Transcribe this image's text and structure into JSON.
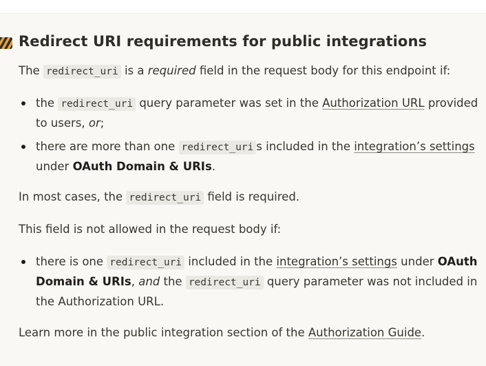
{
  "callout": {
    "icon": "warning-stripe-icon",
    "heading": "Redirect URI requirements for public integrations",
    "intro": {
      "t1": "The ",
      "code": "redirect_uri",
      "t2": " is a ",
      "em": "required",
      "t3": " field in the request body for this endpoint if:"
    },
    "list1": [
      {
        "t1": "the ",
        "code": "redirect_uri",
        "t2": " query parameter was set in the ",
        "link": "Authorization URL",
        "t3": " provided",
        "line2": "to users, ",
        "em": "or",
        "t4": ";"
      },
      {
        "t1": "there are more than one ",
        "code": "redirect_uri",
        "t2": "s included in the ",
        "link": "integration’s settings",
        "line2": "under ",
        "bold": "OAuth Domain & URIs",
        "t3": "."
      }
    ],
    "most_cases": {
      "t1": "In most cases, the ",
      "code": "redirect_uri",
      "t2": " field is required."
    },
    "not_allowed": "This field is not allowed in the request body if:",
    "list2": [
      {
        "t1": "there is one ",
        "code": "redirect_uri",
        "t2": " included in the ",
        "link": "integration’s settings",
        "t3": " under ",
        "bold1": "OAuth",
        "bold2": "Domain & URIs",
        "t4": ", ",
        "em": "and",
        "t5": " the ",
        "code2": "redirect_uri",
        "t6": " query parameter was not included in",
        "line3": "the Authorization URL."
      }
    ],
    "learn_more": {
      "t1": "Learn more in the public integration section of the ",
      "link": "Authorization Guide",
      "t2": "."
    }
  },
  "colors": {
    "callout_bg": "#f9f8f4",
    "code_bg": "#ebe9e4",
    "text": "#37352f",
    "icon_stripe_a": "#e8a33b",
    "icon_stripe_b": "#2f2d28"
  }
}
